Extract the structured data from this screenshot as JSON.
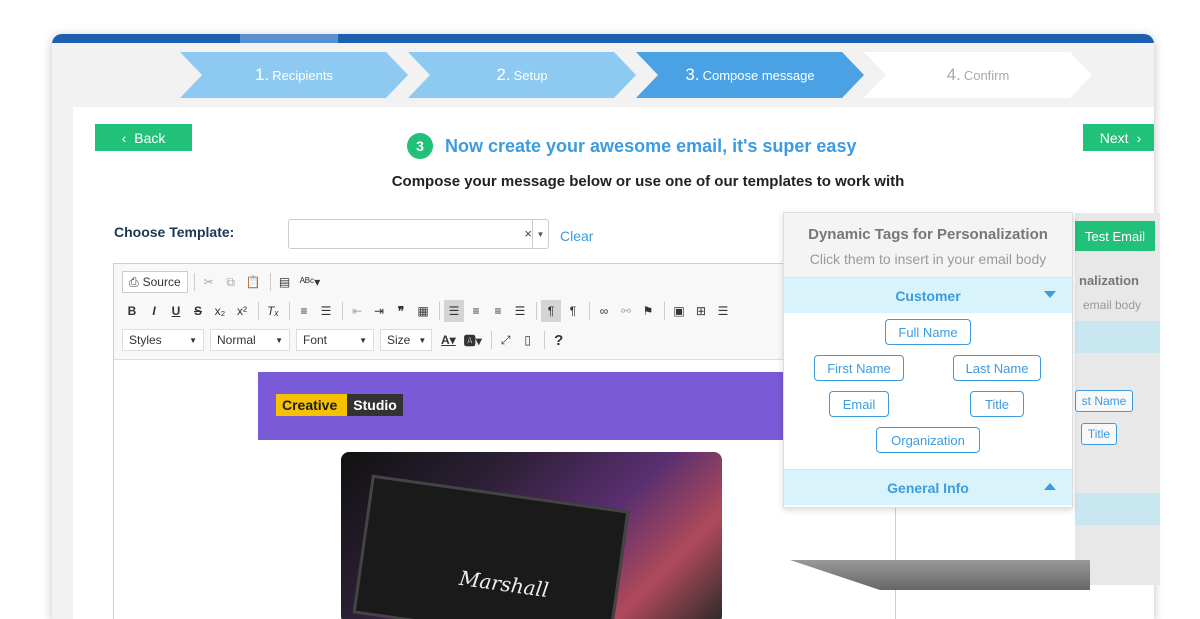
{
  "steps": [
    {
      "num": "1.",
      "label": "Recipients"
    },
    {
      "num": "2.",
      "label": "Setup"
    },
    {
      "num": "3.",
      "label": "Compose message"
    },
    {
      "num": "4.",
      "label": "Confirm"
    }
  ],
  "nav": {
    "back_label": "Back",
    "next_label": "Next"
  },
  "heading": {
    "step_num": "3",
    "title": "Now create your awesome email, it's super easy",
    "subtitle": "Compose your message below or use one of our templates to work with"
  },
  "template": {
    "label": "Choose Template:",
    "value": "",
    "clear_symbol": "×",
    "clear_label": "Clear"
  },
  "toolbar": {
    "source_label": "Source",
    "styles_label": "Styles",
    "format_label": "Normal",
    "font_label": "Font",
    "size_label": "Size",
    "help_label": "?"
  },
  "email": {
    "logo_part1": "Creative",
    "logo_part2": "Studio",
    "amp_brand": "Marshall"
  },
  "dynamic_tags": {
    "title": "Dynamic Tags for Personalization",
    "subtitle": "Click them to insert in your email body",
    "customer_label": "Customer",
    "general_label": "General Info",
    "tags": [
      "Full Name",
      "First Name",
      "Last Name",
      "Email",
      "Title",
      "Organization"
    ]
  },
  "background_panel": {
    "test_email_label": "Test Email",
    "title_fragment": "nalization",
    "subtitle_fragment": "email body",
    "tag1": "st Name",
    "tag2": "Title"
  },
  "colors": {
    "accent_green": "#22c17a",
    "accent_blue": "#3d9be0",
    "active_step": "#4aa2e4"
  }
}
